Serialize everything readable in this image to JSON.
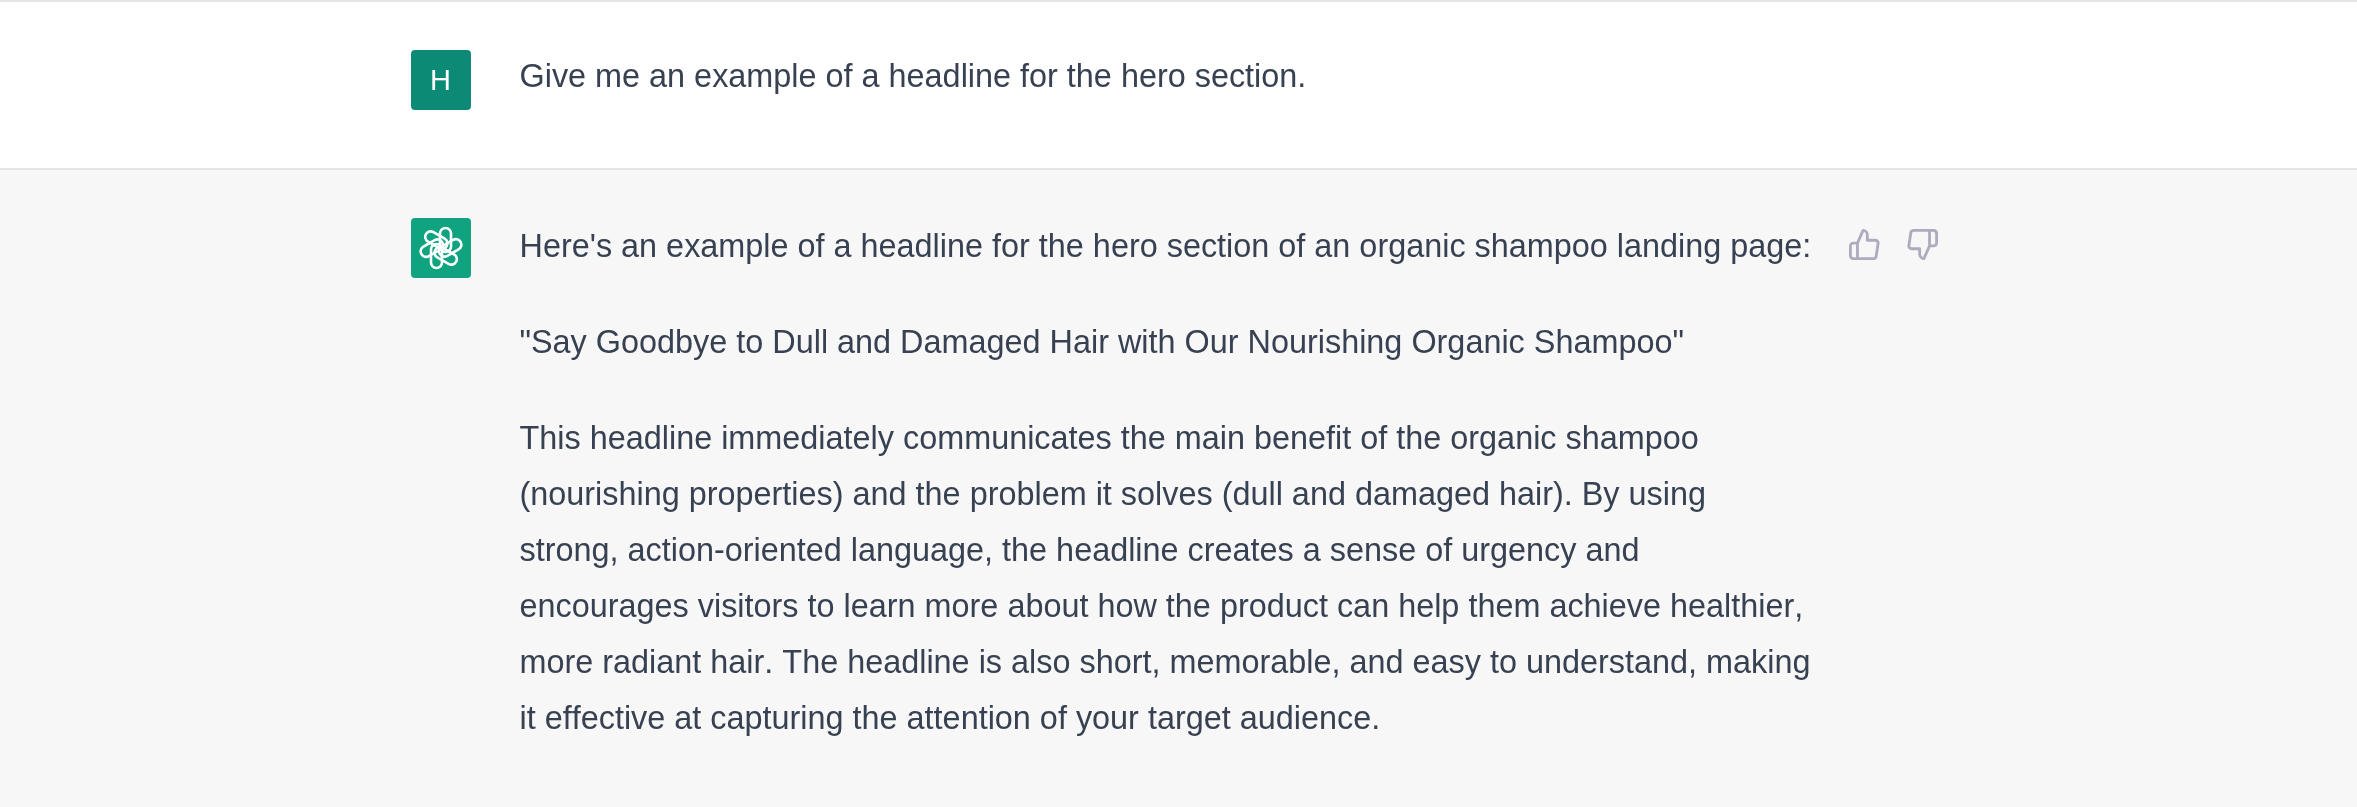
{
  "messages": [
    {
      "kind": "user",
      "avatar": "H",
      "paragraphs": [
        "Give me an example of a headline for the hero section."
      ]
    },
    {
      "kind": "assistant",
      "paragraphs": [
        "Here's an example of a headline for the hero section of an organic shampoo landing page:",
        "\"Say Goodbye to Dull and Damaged Hair with Our Nourishing Organic Shampoo\"",
        "This headline immediately communicates the main benefit of the organic shampoo (nourishing properties) and the problem it solves (dull and damaged hair). By using strong, action-oriented language, the headline creates a sense of urgency and encourages visitors to learn more about how the product can help them achieve healthier, more radiant hair. The headline is also short, memorable, and easy to understand, making it effective at capturing the attention of your target audience."
      ]
    }
  ]
}
